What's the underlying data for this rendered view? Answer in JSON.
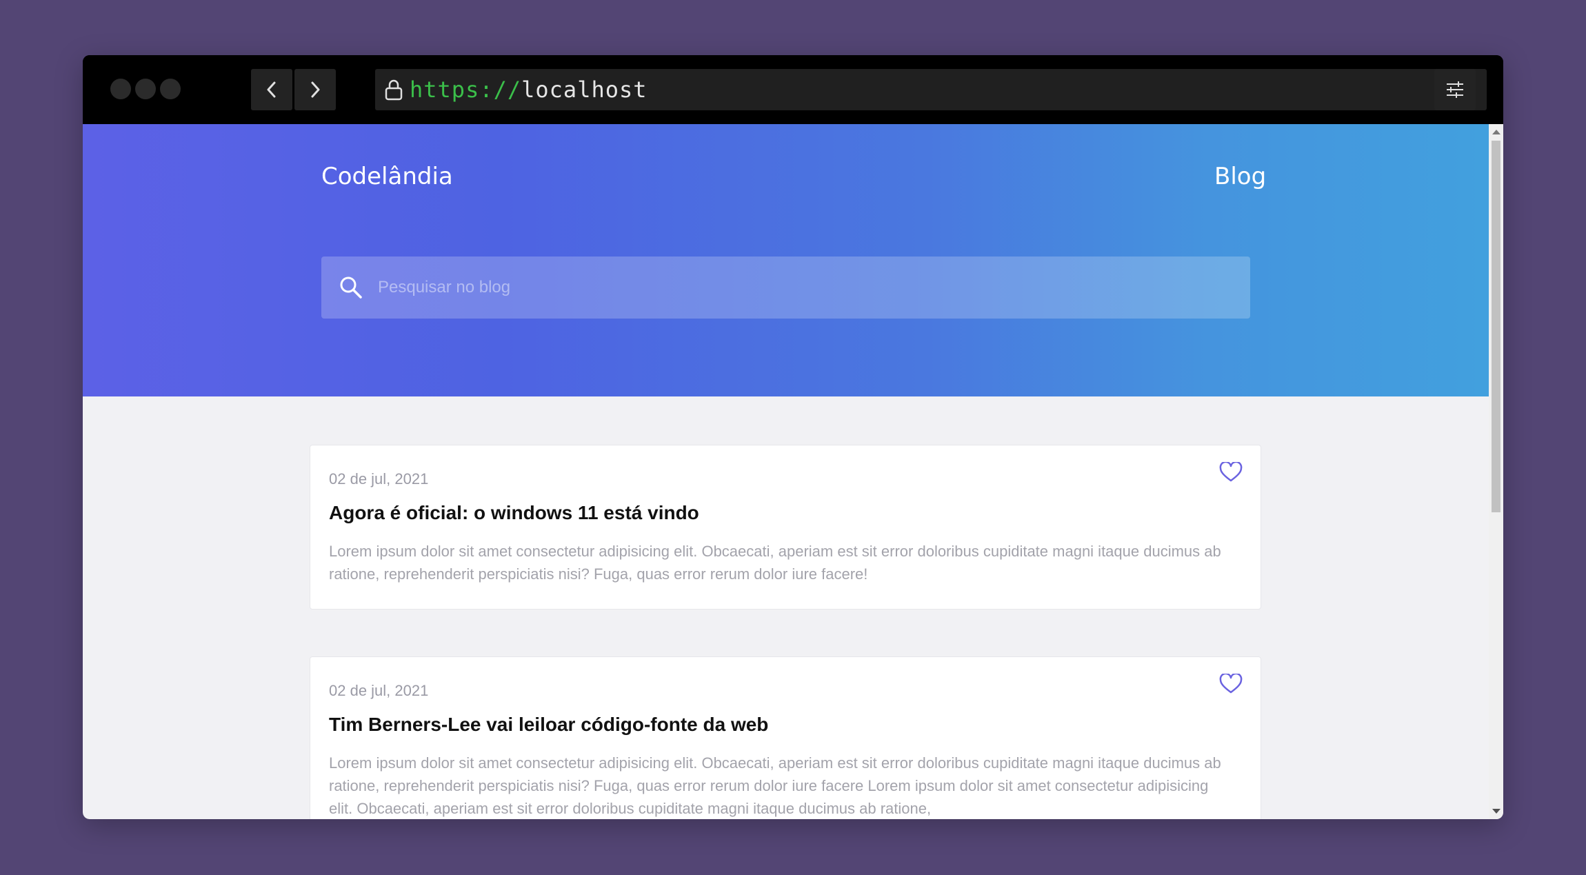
{
  "browser": {
    "url_scheme": "https://",
    "url_host": "localhost"
  },
  "site": {
    "brand": "Codelândia",
    "nav_link": "Blog",
    "search_placeholder": "Pesquisar no blog"
  },
  "posts": [
    {
      "date": "02 de jul, 2021",
      "title": "Agora é oficial: o windows 11 está vindo",
      "excerpt": "Lorem ipsum dolor sit amet consectetur adipisicing elit. Obcaecati, aperiam est sit error doloribus cupiditate magni itaque ducimus ab ratione, reprehenderit perspiciatis nisi? Fuga, quas error rerum dolor iure facere!"
    },
    {
      "date": "02 de jul, 2021",
      "title": "Tim Berners-Lee vai leiloar código-fonte da web",
      "excerpt": "Lorem ipsum dolor sit amet consectetur adipisicing elit. Obcaecati, aperiam est sit error doloribus cupiditate magni itaque ducimus ab ratione, reprehenderit perspiciatis nisi? Fuga, quas error rerum dolor iure facere Lorem ipsum dolor sit amet consectetur adipisicing elit. Obcaecati, aperiam est sit error doloribus cupiditate magni itaque ducimus ab ratione,"
    }
  ],
  "icons": {
    "lock": "lock-icon",
    "back": "chevron-left-icon",
    "forward": "chevron-right-icon",
    "settings": "sliders-icon",
    "search": "search-icon",
    "favorite": "heart-icon"
  },
  "colors": {
    "page_background": "#534574",
    "hero_gradient_start": "#5c61e6",
    "hero_gradient_end": "#42a0de",
    "url_scheme": "#3bbf4a",
    "heart": "#6a62e0"
  }
}
